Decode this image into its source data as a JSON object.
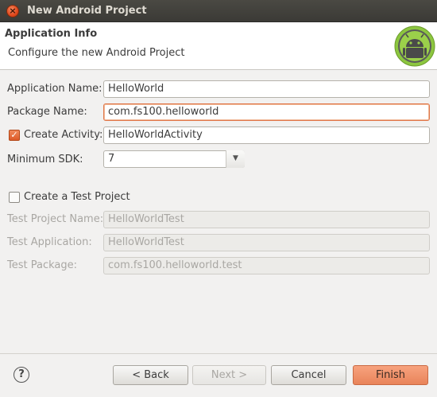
{
  "window": {
    "title": "New Android Project"
  },
  "header": {
    "title": "Application Info",
    "description": "Configure the new Android Project",
    "logo_icon": "android-robot-icon"
  },
  "form": {
    "application_name": {
      "label": "Application Name:",
      "value": "HelloWorld"
    },
    "package_name": {
      "label": "Package Name:",
      "value": "com.fs100.helloworld"
    },
    "create_activity": {
      "label": "Create Activity:",
      "checked": true,
      "value": "HelloWorldActivity"
    },
    "minimum_sdk": {
      "label": "Minimum SDK:",
      "value": "7"
    },
    "create_test_project": {
      "label": "Create a Test Project",
      "checked": false
    },
    "test_project_name": {
      "label": "Test Project Name:",
      "value": "HelloWorldTest"
    },
    "test_application": {
      "label": "Test Application:",
      "value": "HelloWorldTest"
    },
    "test_package": {
      "label": "Test Package:",
      "value": "com.fs100.helloworld.test"
    }
  },
  "buttons": {
    "help": "?",
    "back": "< Back",
    "next": "Next >",
    "cancel": "Cancel",
    "finish": "Finish"
  },
  "colors": {
    "accent": "#e9845a",
    "titlebar": "#3b3a36"
  }
}
